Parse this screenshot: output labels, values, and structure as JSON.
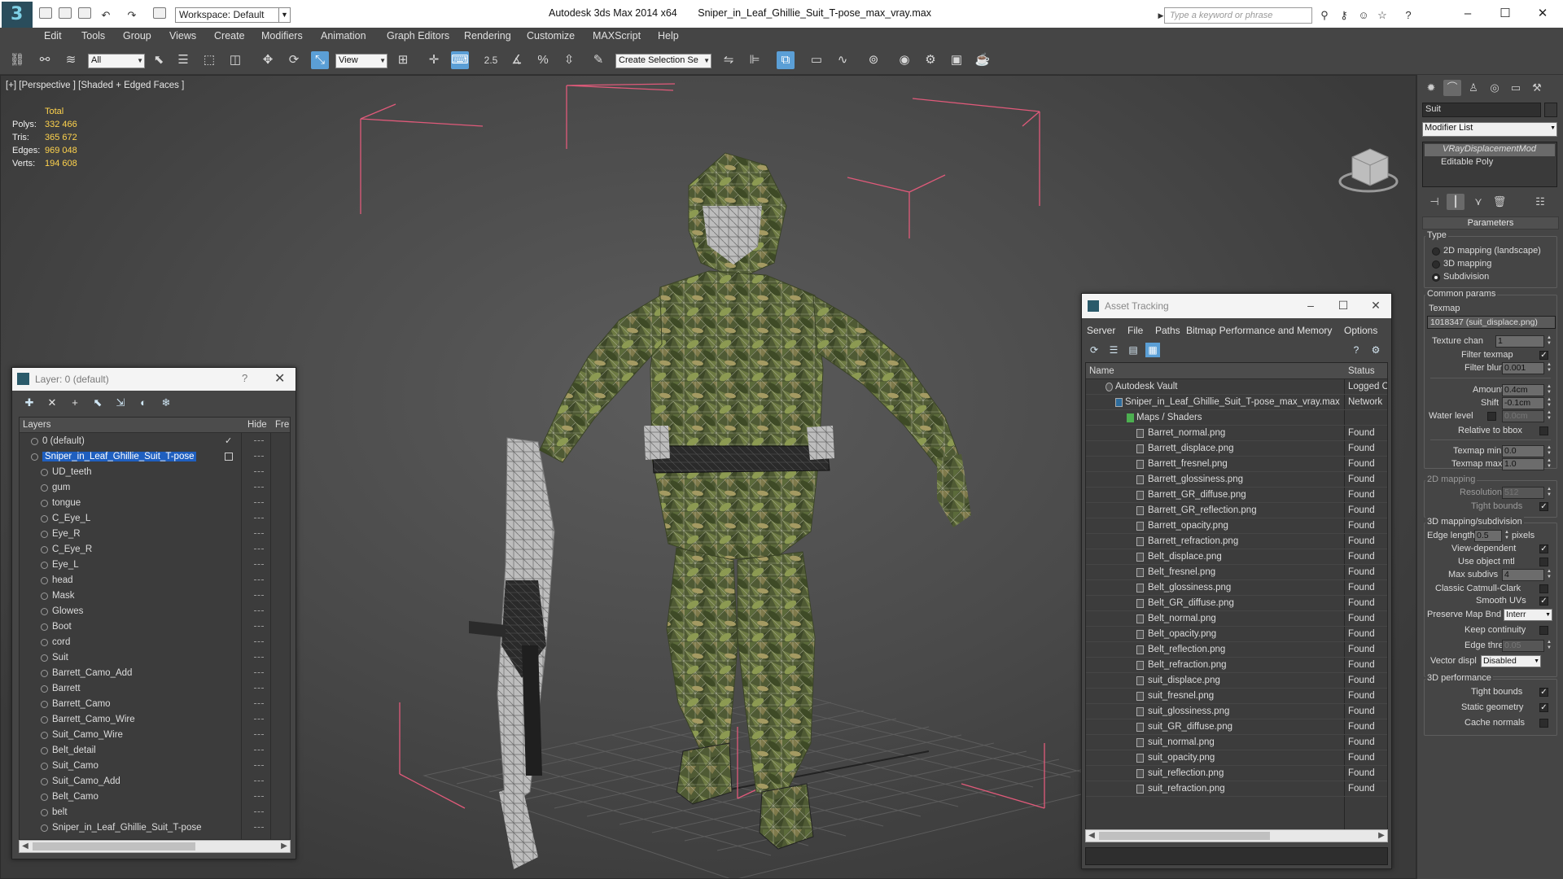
{
  "app": {
    "workspace_label": "Workspace: Default",
    "title_app": "Autodesk 3ds Max  2014 x64",
    "title_file": "Sniper_in_Leaf_Ghillie_Suit_T-pose_max_vray.max",
    "search_placeholder": "Type a keyword or phrase"
  },
  "menu": [
    "Edit",
    "Tools",
    "Group",
    "Views",
    "Create",
    "Modifiers",
    "Animation",
    "Graph Editors",
    "Rendering",
    "Customize",
    "MAXScript",
    "Help"
  ],
  "toolbar": {
    "filter_value": "All",
    "refcoord_value": "View",
    "snap_value": "2.5",
    "selset_value": "Create Selection Se"
  },
  "viewport": {
    "label": "[+] [Perspective ] [Shaded + Edged Faces ]",
    "stats_header": "Total",
    "stats": [
      {
        "k": "Polys:",
        "v": "332 466"
      },
      {
        "k": "Tris:",
        "v": "365 672"
      },
      {
        "k": "Edges:",
        "v": "969 048"
      },
      {
        "k": "Verts:",
        "v": "194 608"
      }
    ]
  },
  "cmd": {
    "object_name": "Suit",
    "modifier_list": "Modifier List",
    "stack": [
      "VRayDisplacementMod",
      "Editable Poly"
    ],
    "params_title": "Parameters",
    "type_label": "Type",
    "type_options": [
      "2D mapping (landscape)",
      "3D mapping",
      "Subdivision"
    ],
    "common_label": "Common params",
    "texmap_label": "Texmap",
    "texmap_value": "1018347 (suit_displace.png)",
    "texture_chan_label": "Texture chan",
    "texture_chan_value": "1",
    "filter_texmap_label": "Filter texmap",
    "filter_blur_label": "Filter blur",
    "filter_blur_value": "0.001",
    "amount_label": "Amount",
    "amount_value": "0.4cm",
    "shift_label": "Shift",
    "shift_value": "-0.1cm",
    "water_label": "Water level",
    "water_value": "0.0cm",
    "relbbox_label": "Relative to bbox",
    "texmin_label": "Texmap min",
    "texmin_value": "0.0",
    "texmax_label": "Texmap max",
    "texmax_value": "1.0",
    "map2d_label": "2D mapping",
    "resolution_label": "Resolution",
    "resolution_value": "512",
    "tight_label": "Tight bounds",
    "sub_label": "3D mapping/subdivision",
    "edge_len_label": "Edge length",
    "edge_len_value": "0.5",
    "pixels_label": "pixels",
    "viewdep_label": "View-dependent",
    "useobj_label": "Use object mtl",
    "maxsub_label": "Max subdivs",
    "maxsub_value": "4",
    "catmull_label": "Classic Catmull-Clark",
    "smoothuv_label": "Smooth UVs",
    "preserve_label": "Preserve Map Bnd",
    "preserve_value": "Interr",
    "keepcont_label": "Keep continuity",
    "edgethresh_label": "Edge thresh",
    "edgethresh_value": "0.05",
    "vecdisp_label": "Vector displ",
    "vecdisp_value": "Disabled",
    "perf_label": "3D performance",
    "perf_tight_label": "Tight bounds",
    "static_label": "Static geometry",
    "cache_label": "Cache normals"
  },
  "layer_dialog": {
    "title": "Layer: 0 (default)",
    "help": "?",
    "col_layers": "Layers",
    "col_hide": "Hide",
    "col_freeze": "Fre",
    "rows": [
      "0 (default)",
      "Sniper_in_Leaf_Ghillie_Suit_T-pose",
      "UD_teeth",
      "gum",
      "tongue",
      "C_Eye_L",
      "Eye_R",
      "C_Eye_R",
      "Eye_L",
      "head",
      "Mask",
      "Glowes",
      "Boot",
      "cord",
      "Suit",
      "Barrett_Camo_Add",
      "Barrett",
      "Barrett_Camo",
      "Barrett_Camo_Wire",
      "Suit_Camo_Wire",
      "Belt_detail",
      "Suit_Camo",
      "Suit_Camo_Add",
      "Belt_Camo",
      "belt",
      "Sniper_in_Leaf_Ghillie_Suit_T-pose"
    ]
  },
  "asset_dialog": {
    "title": "Asset Tracking",
    "menu": [
      "Server",
      "File",
      "Paths",
      "Bitmap Performance and Memory",
      "Options"
    ],
    "col_name": "Name",
    "col_status": "Status",
    "vault": {
      "name": "Autodesk Vault",
      "status": "Logged O"
    },
    "file": {
      "name": "Sniper_in_Leaf_Ghillie_Suit_T-pose_max_vray.max",
      "status": "Network"
    },
    "maps": "Maps / Shaders",
    "files": [
      {
        "name": "Barret_normal.png",
        "status": "Found"
      },
      {
        "name": "Barrett_displace.png",
        "status": "Found"
      },
      {
        "name": "Barrett_fresnel.png",
        "status": "Found"
      },
      {
        "name": "Barrett_glossiness.png",
        "status": "Found"
      },
      {
        "name": "Barrett_GR_diffuse.png",
        "status": "Found"
      },
      {
        "name": "Barrett_GR_reflection.png",
        "status": "Found"
      },
      {
        "name": "Barrett_opacity.png",
        "status": "Found"
      },
      {
        "name": "Barrett_refraction.png",
        "status": "Found"
      },
      {
        "name": "Belt_displace.png",
        "status": "Found"
      },
      {
        "name": "Belt_fresnel.png",
        "status": "Found"
      },
      {
        "name": "Belt_glossiness.png",
        "status": "Found"
      },
      {
        "name": "Belt_GR_diffuse.png",
        "status": "Found"
      },
      {
        "name": "Belt_normal.png",
        "status": "Found"
      },
      {
        "name": "Belt_opacity.png",
        "status": "Found"
      },
      {
        "name": "Belt_reflection.png",
        "status": "Found"
      },
      {
        "name": "Belt_refraction.png",
        "status": "Found"
      },
      {
        "name": "suit_displace.png",
        "status": "Found"
      },
      {
        "name": "suit_fresnel.png",
        "status": "Found"
      },
      {
        "name": "suit_glossiness.png",
        "status": "Found"
      },
      {
        "name": "suit_GR_diffuse.png",
        "status": "Found"
      },
      {
        "name": "suit_normal.png",
        "status": "Found"
      },
      {
        "name": "suit_opacity.png",
        "status": "Found"
      },
      {
        "name": "suit_reflection.png",
        "status": "Found"
      },
      {
        "name": "suit_refraction.png",
        "status": "Found"
      }
    ]
  },
  "colors": {
    "accent": "#5b9fd6",
    "stats_value": "#ffd34d",
    "selection": "#1f5fbf",
    "bbox": "#e05a7a"
  }
}
